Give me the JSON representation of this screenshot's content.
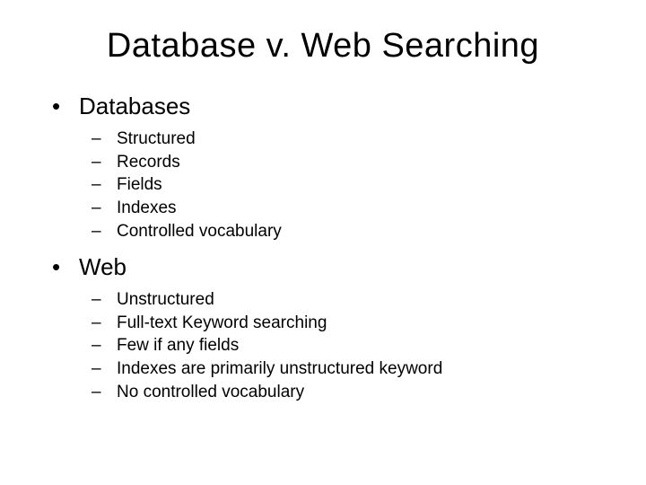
{
  "title": "Database v. Web Searching",
  "sections": [
    {
      "label": "Databases",
      "items": [
        "Structured",
        "Records",
        "Fields",
        "Indexes",
        "Controlled vocabulary"
      ]
    },
    {
      "label": "Web",
      "items": [
        "Unstructured",
        "Full-text Keyword searching",
        "Few if any fields",
        "Indexes are primarily unstructured keyword",
        "No controlled vocabulary"
      ]
    }
  ]
}
